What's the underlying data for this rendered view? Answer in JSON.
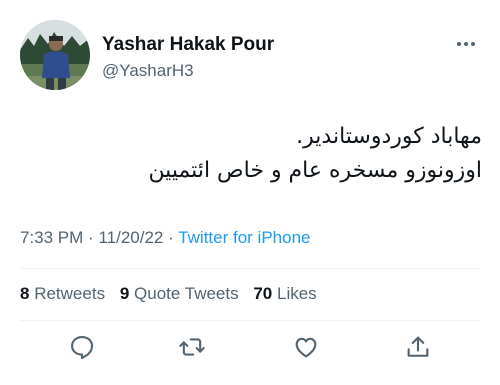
{
  "user": {
    "display_name": "Yashar Hakak Pour",
    "handle": "@YasharH3"
  },
  "tweet": {
    "lines": [
      "مهاباد کوردوستاندیر.",
      "اوزونوزو مسخره عام و خاص ائتمیین"
    ],
    "time": "7:33 PM",
    "separator": "·",
    "date": "11/20/22",
    "source": "Twitter for iPhone"
  },
  "stats": {
    "retweets_count": "8",
    "retweets_label": "Retweets",
    "quotes_count": "9",
    "quotes_label": "Quote Tweets",
    "likes_count": "70",
    "likes_label": "Likes"
  },
  "actions": [
    "reply-icon",
    "retweet-icon",
    "like-icon",
    "share-icon"
  ],
  "colors": {
    "text": "#0f1419",
    "secondary": "#536471",
    "link": "#1d9bf0",
    "divider": "#eff3f4"
  }
}
